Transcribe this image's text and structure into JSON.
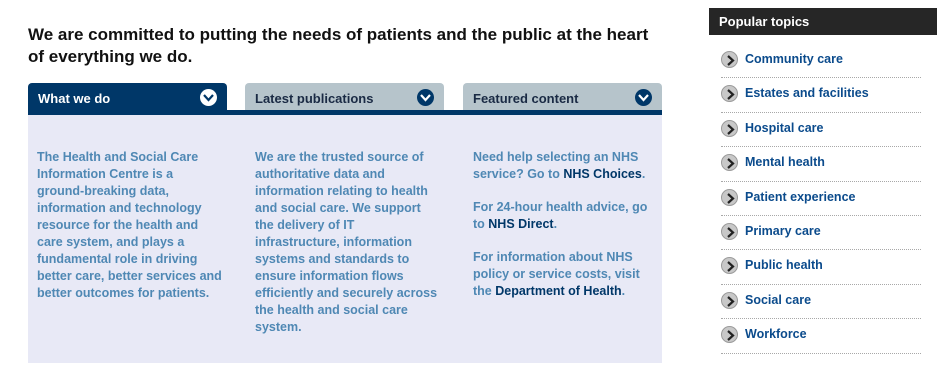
{
  "headline": "We are committed to putting the needs of patients and the public at the heart of everything we do.",
  "tabs": [
    {
      "label": "What we do",
      "active": true
    },
    {
      "label": "Latest publications",
      "active": false
    },
    {
      "label": "Featured content",
      "active": false
    }
  ],
  "columns": {
    "what_we_do": "The Health and Social Care Information Centre is a ground-breaking data, information and technology resource for the health and care system, and plays a fundamental role in driving better care, better services and better outcomes for patients.",
    "publications": "We are the trusted source of authoritative data and information relating to health and social care. We support the delivery of IT infrastructure, information systems and standards to ensure information flows efficiently and securely across the health and social care system.",
    "featured": {
      "p1_text": "Need help selecting an NHS service? Go to ",
      "p1_link": "NHS Choices",
      "p1_end": ".",
      "p2_text": "For 24-hour health advice, go to ",
      "p2_link": "NHS Direct",
      "p2_end": ".",
      "p3_text": "For information about NHS policy or service costs, visit the ",
      "p3_link": "Department of Health",
      "p3_end": "."
    }
  },
  "sidebar": {
    "title": "Popular topics",
    "items": [
      "Community care",
      "Estates and facilities",
      "Hospital care",
      "Mental health",
      "Patient experience",
      "Primary care",
      "Public health",
      "Social care",
      "Workforce"
    ]
  },
  "colors": {
    "navy": "#003768",
    "panel_bg": "#e8e9f6",
    "panel_text": "#4f88b4",
    "inactive_tab": "#b6c4cb",
    "sidebar_head": "#262626",
    "topic_link": "#0b4b8c"
  }
}
